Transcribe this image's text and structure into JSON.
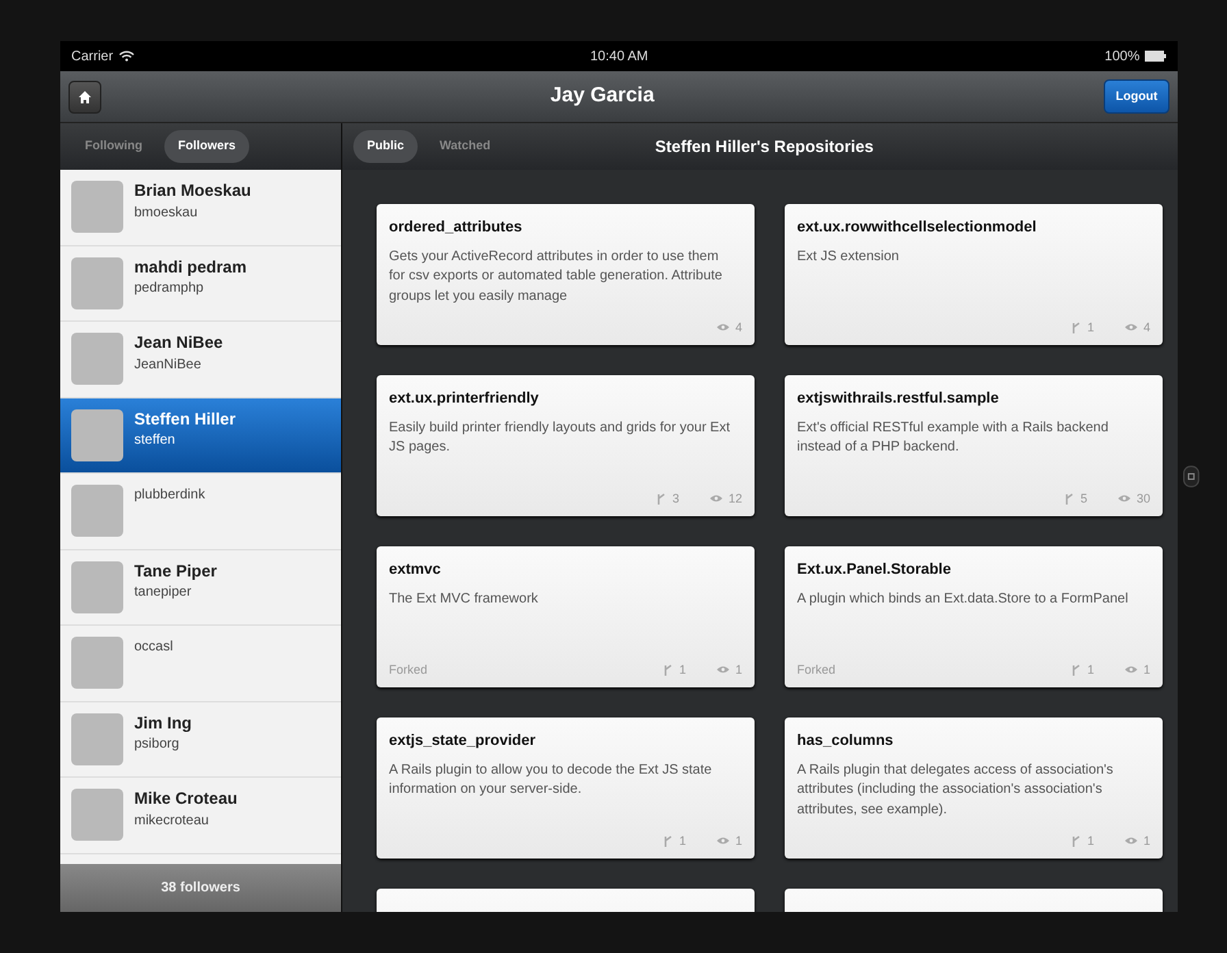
{
  "status_bar": {
    "carrier": "Carrier",
    "time": "10:40 AM",
    "battery": "100%"
  },
  "nav_bar": {
    "title": "Jay Garcia",
    "logout": "Logout"
  },
  "sidebar": {
    "tabs": [
      {
        "label": "Following",
        "selected": false
      },
      {
        "label": "Followers",
        "selected": true
      }
    ],
    "users": [
      {
        "name": "Brian Moeskau",
        "login": "bmoeskau",
        "selected": false
      },
      {
        "name": "mahdi pedram",
        "login": "pedramphp",
        "selected": false
      },
      {
        "name": "Jean NiBee",
        "login": "JeanNiBee",
        "selected": false
      },
      {
        "name": "Steffen Hiller",
        "login": "steffen",
        "selected": true
      },
      {
        "login": "plubberdink",
        "selected": false
      },
      {
        "name": "Tane Piper",
        "login": "tanepiper",
        "selected": false
      },
      {
        "login": "occasl",
        "selected": false
      },
      {
        "name": "Jim Ing",
        "login": "psiborg",
        "selected": false
      },
      {
        "name": "Mike Croteau",
        "login": "mikecroteau",
        "selected": false
      }
    ],
    "footer": "38 followers"
  },
  "repos": {
    "tabs": [
      {
        "label": "Public",
        "selected": true
      },
      {
        "label": "Watched",
        "selected": false
      }
    ],
    "title": "Steffen Hiller's Repositories",
    "cards": [
      {
        "name": "ordered_attributes",
        "description": "Gets your ActiveRecord attributes in order to use them for csv exports or automated table generation. Attribute groups let you easily manage",
        "watchers": "4"
      },
      {
        "name": "ext.ux.rowwithcellselectionmodel",
        "description": "Ext JS extension",
        "forks": "1",
        "watchers": "4"
      },
      {
        "name": "ext.ux.printerfriendly",
        "description": "Easily build printer friendly layouts and grids for your Ext JS pages.",
        "forks": "3",
        "watchers": "12"
      },
      {
        "name": "extjswithrails.restful.sample",
        "description": "Ext's official RESTful example with a Rails backend instead of a PHP backend.",
        "forks": "5",
        "watchers": "30"
      },
      {
        "name": "extmvc",
        "description": "The Ext MVC framework",
        "status": "Forked",
        "forks": "1",
        "watchers": "1"
      },
      {
        "name": "Ext.ux.Panel.Storable",
        "description": "A plugin which binds an Ext.data.Store to a FormPanel",
        "status": "Forked",
        "forks": "1",
        "watchers": "1"
      },
      {
        "name": "extjs_state_provider",
        "description": "A Rails plugin to allow you to decode the Ext JS state information on your server-side.",
        "forks": "1",
        "watchers": "1"
      },
      {
        "name": "has_columns",
        "description": "A Rails plugin that delegates access of association's attributes (including the association's association's attributes, see example).",
        "forks": "1",
        "watchers": "1"
      }
    ],
    "more_cards_below": true
  }
}
